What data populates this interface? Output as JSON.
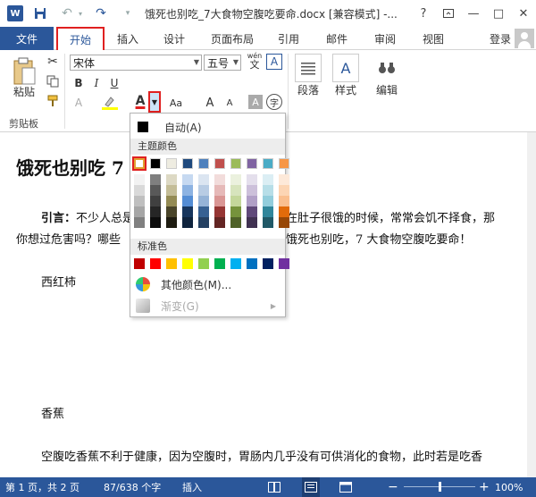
{
  "titlebar": {
    "app_icon": "W",
    "title": "饿死也别吃_7大食物空腹吃要命.docx [兼容模式] -...",
    "help": "?",
    "minimize": "—",
    "restore": "□",
    "close": "✕"
  },
  "tabs": {
    "file": "文件",
    "home": "开始",
    "insert": "插入",
    "design": "设计",
    "layout": "页面布局",
    "references": "引用",
    "mailings": "邮件",
    "review": "审阅",
    "view": "视图",
    "login": "登录"
  },
  "ribbon": {
    "paste_label": "粘贴",
    "clipboard_label": "剪贴板",
    "font_name": "宋体",
    "font_size": "五号",
    "wen_label": "wén",
    "bold": "B",
    "italic": "I",
    "underline": "U",
    "font_color": "A",
    "aa": "Aa",
    "grow": "A",
    "shrink": "A",
    "char_shading": "A",
    "circle_char": "字",
    "paragraph_label": "段落",
    "styles_label": "样式",
    "editing_label": "编辑"
  },
  "document": {
    "title": "饿死也别吃 7",
    "intro_bold": "引言：",
    "intro_line1_a": "不少人总是",
    "intro_line1_b": "在肚子很饿的时候，常常会饥不择食，那",
    "intro_line2_a": "你想过危害吗？哪些",
    "intro_line2_b": "饿死也别吃，7 大食物空腹吃要命！",
    "item1": "西红柿",
    "item2": "香蕉",
    "last_line": "空腹吃香蕉不利于健康，因为空腹时，胃肠内几乎没有可供消化的食物，此时若是吃香"
  },
  "color_menu": {
    "auto_label": "自动(A)",
    "theme_header": "主题颜色",
    "standard_header": "标准色",
    "more_colors": "其他颜色(M)...",
    "gradient": "渐变(G)",
    "theme_colors": [
      "#ffffff",
      "#000000",
      "#e7e6e6",
      "#44546a",
      "#4472c4",
      "#ed7d31",
      "#a5a5a5",
      "#ffc000",
      "#5b9bd5",
      "#70ad47"
    ],
    "theme_row_colors": [
      "#ffffff",
      "#000000",
      "#eeece1",
      "#1f497d",
      "#4f81bd",
      "#c0504d",
      "#9bbb59",
      "#8064a2",
      "#4bacc6",
      "#f79646"
    ],
    "shade_columns": [
      [
        "#f2f2f2",
        "#d9d9d9",
        "#bfbfbf",
        "#a6a6a6",
        "#808080"
      ],
      [
        "#7f7f7f",
        "#595959",
        "#404040",
        "#262626",
        "#0d0d0d"
      ],
      [
        "#ddd9c4",
        "#c4bd97",
        "#948b54",
        "#4a452a",
        "#1e1c11"
      ],
      [
        "#c6d9f1",
        "#8db3e2",
        "#548dd4",
        "#17365d",
        "#0f243e"
      ],
      [
        "#dbe5f1",
        "#b8cce4",
        "#95b3d7",
        "#366092",
        "#244062"
      ],
      [
        "#f2dcdb",
        "#e6b9b8",
        "#da9694",
        "#963634",
        "#632523"
      ],
      [
        "#ebf1de",
        "#d7e4bd",
        "#c4d79b",
        "#76933c",
        "#4f6228"
      ],
      [
        "#e4dfec",
        "#ccc0da",
        "#b1a0c7",
        "#60497a",
        "#403151"
      ],
      [
        "#dbeef4",
        "#b7dee8",
        "#92cddc",
        "#31869b",
        "#215967"
      ],
      [
        "#fde9d9",
        "#fcd5b4",
        "#fabf8f",
        "#e26b0a",
        "#974706"
      ]
    ],
    "standard_colors": [
      "#c00000",
      "#ff0000",
      "#ffc000",
      "#ffff00",
      "#92d050",
      "#00b050",
      "#00b0f0",
      "#0070c0",
      "#002060",
      "#7030a0"
    ]
  },
  "statusbar": {
    "pages": "第 1 页，共 2 页",
    "words": "87/638 个字",
    "mode": "插入",
    "zoom_minus": "−",
    "zoom_plus": "+",
    "zoom": "100%",
    "zoom_fraction": 0.5
  }
}
